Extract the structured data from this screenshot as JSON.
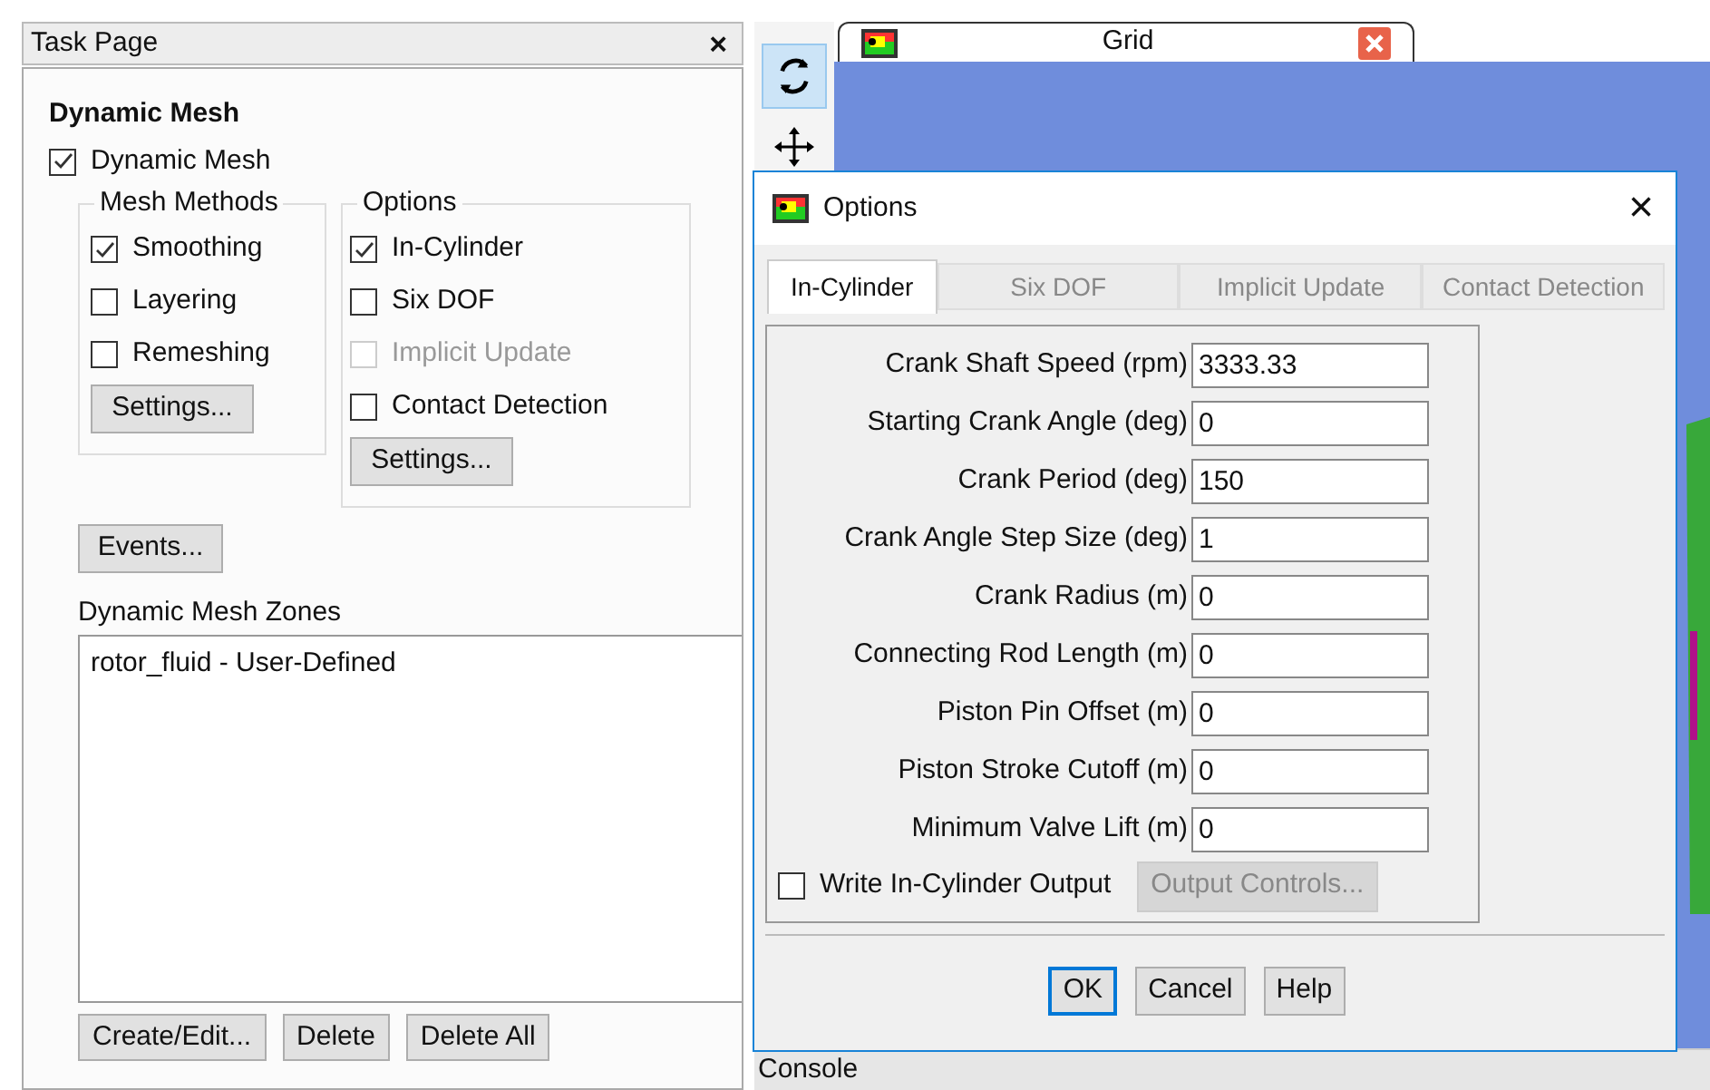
{
  "task_page": {
    "title": "Task Page",
    "close": "×",
    "heading": "Dynamic Mesh",
    "dynamic_mesh": {
      "label": "Dynamic Mesh",
      "checked": true
    },
    "mesh_methods": {
      "title": "Mesh Methods",
      "items": [
        {
          "label": "Smoothing",
          "checked": true
        },
        {
          "label": "Layering",
          "checked": false
        },
        {
          "label": "Remeshing",
          "checked": false
        }
      ],
      "button": "Settings..."
    },
    "options": {
      "title": "Options",
      "items": [
        {
          "label": "In-Cylinder",
          "checked": true,
          "disabled": false
        },
        {
          "label": "Six DOF",
          "checked": false,
          "disabled": false
        },
        {
          "label": "Implicit Update",
          "checked": false,
          "disabled": true
        },
        {
          "label": "Contact Detection",
          "checked": false,
          "disabled": false
        }
      ],
      "button": "Settings..."
    },
    "events_button": "Events...",
    "zones": {
      "title": "Dynamic Mesh Zones",
      "items": [
        "rotor_fluid - User-Defined"
      ]
    },
    "buttons": [
      "Create/Edit...",
      "Delete",
      "Delete All"
    ]
  },
  "graphics": {
    "tab": "Grid",
    "console": "Console"
  },
  "dialog": {
    "title": "Options",
    "close": "×",
    "tabs": [
      {
        "label": "In-Cylinder",
        "selected": true
      },
      {
        "label": "Six DOF",
        "selected": false
      },
      {
        "label": "Implicit Update",
        "selected": false
      },
      {
        "label": "Contact Detection",
        "selected": false
      }
    ],
    "fields": [
      {
        "label": "Crank Shaft Speed (rpm)",
        "value": "3333.33"
      },
      {
        "label": "Starting Crank Angle (deg)",
        "value": "0"
      },
      {
        "label": "Crank Period (deg)",
        "value": "150"
      },
      {
        "label": "Crank Angle Step Size (deg)",
        "value": "1"
      },
      {
        "label": "Crank Radius (m)",
        "value": "0"
      },
      {
        "label": "Connecting Rod Length (m)",
        "value": "0"
      },
      {
        "label": "Piston Pin Offset (m)",
        "value": "0"
      },
      {
        "label": "Piston Stroke Cutoff (m)",
        "value": "0"
      },
      {
        "label": "Minimum Valve Lift (m)",
        "value": "0"
      }
    ],
    "write_output": {
      "label": "Write In-Cylinder Output",
      "checked": false
    },
    "output_controls": {
      "label": "Output Controls...",
      "disabled": true
    },
    "buttons": [
      {
        "label": "OK",
        "default": true
      },
      {
        "label": "Cancel",
        "default": false
      },
      {
        "label": "Help",
        "default": false
      }
    ]
  }
}
